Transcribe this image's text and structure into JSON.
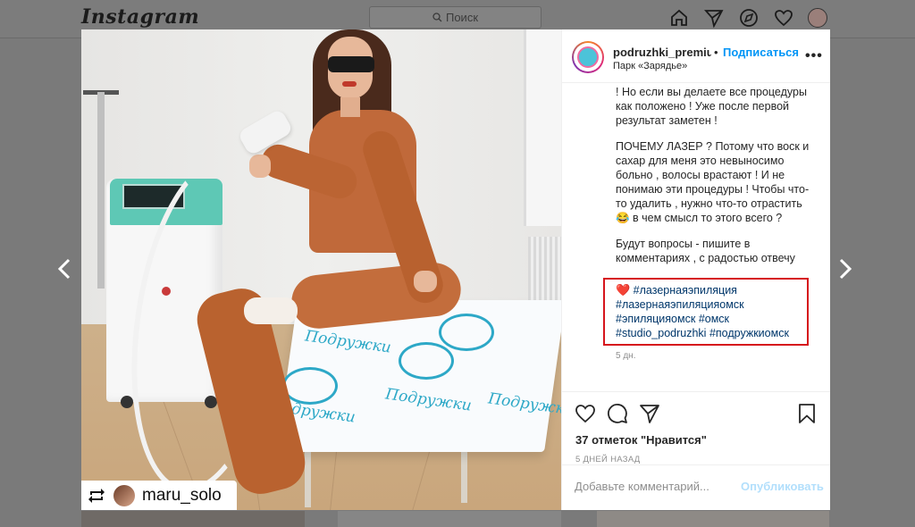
{
  "header": {
    "logo": "Instagram",
    "search_placeholder": "Поиск"
  },
  "post": {
    "username": "podruzhki_premium",
    "dot": "•",
    "follow_label": "Подписаться",
    "location": "Парк «Зарядье»",
    "more_label": "•••",
    "repost_username": "maru_solo",
    "bed_print_text": "Подружки",
    "caption_paragraphs": [
      "! Но если вы делаете все процедуры как положено ! Уже после первой результат заметен !",
      "ПОЧЕМУ ЛАЗЕР ? Потому что воск и сахар для меня это невыносимо больно , волосы врастают ! И не понимаю эти процедуры ! Чтобы что-то удалить , нужно что-то отрастить 😂 в чем смысл то этого всего ?",
      "Будут вопросы - пишите в комментариях , с радостью отвечу"
    ],
    "hashtags": [
      "#лазернаяэпиляция",
      "#лазернаяэпиляцияомск",
      "#эпиляцияомск",
      "#омск",
      "#studio_podruzhki",
      "#подружкиомск"
    ],
    "heart_emoji": "❤️",
    "caption_time": "5 дн.",
    "likes_text": "37 отметок \"Нравится\"",
    "posted_ago": "5 ДНЕЙ НАЗАД",
    "comment_placeholder": "Добавьте комментарий...",
    "publish_label": "Опубликовать"
  },
  "icons": {
    "home": "home-icon",
    "direct": "paper-plane-icon",
    "explore": "compass-icon",
    "activity": "heart-icon",
    "like": "heart-outline-icon",
    "comment": "speech-bubble-icon",
    "share": "paper-plane-icon",
    "save": "bookmark-icon",
    "repost": "repost-icon",
    "prev": "chevron-left-icon",
    "next": "chevron-right-icon"
  },
  "colors": {
    "link_blue": "#0095f6",
    "hashtag_blue": "#00376b",
    "highlight_red": "#d6141c"
  }
}
